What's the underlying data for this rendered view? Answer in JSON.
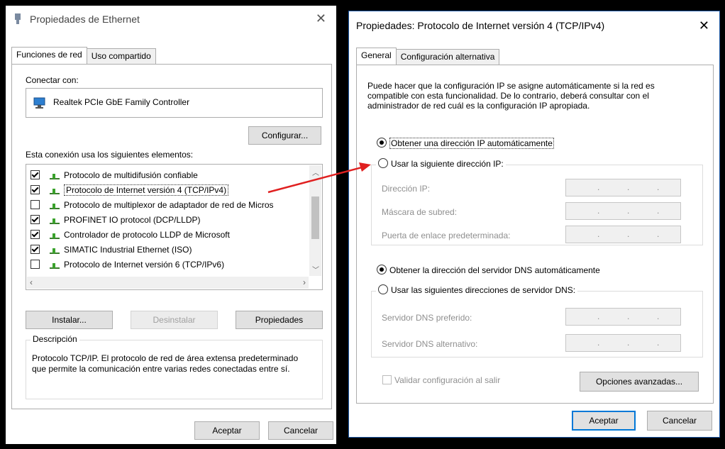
{
  "left": {
    "title": "Propiedades de Ethernet",
    "tabs": [
      "Funciones de red",
      "Uso compartido"
    ],
    "connect_label": "Conectar con:",
    "adapter": "Realtek PCIe GbE Family Controller",
    "configure": "Configurar...",
    "elements_label": "Esta conexión usa los siguientes elementos:",
    "items": [
      {
        "label": "Protocolo de multidifusión confiable",
        "checked": true
      },
      {
        "label": "Protocolo de Internet versión 4 (TCP/IPv4)",
        "checked": true
      },
      {
        "label": "Protocolo de multiplexor de adaptador de red de Micros",
        "checked": false
      },
      {
        "label": "PROFINET IO protocol (DCP/LLDP)",
        "checked": true
      },
      {
        "label": "Controlador de protocolo LLDP de Microsoft",
        "checked": true
      },
      {
        "label": "SIMATIC Industrial Ethernet (ISO)",
        "checked": true
      },
      {
        "label": "Protocolo de Internet versión 6 (TCP/IPv6)",
        "checked": false
      }
    ],
    "install": "Instalar...",
    "uninstall": "Desinstalar",
    "properties": "Propiedades",
    "description_legend": "Descripción",
    "description": "Protocolo TCP/IP. El protocolo de red de área extensa predeterminado que permite la comunicación entre varias redes conectadas entre sí.",
    "ok": "Aceptar",
    "cancel": "Cancelar"
  },
  "right": {
    "title": "Propiedades: Protocolo de Internet versión 4 (TCP/IPv4)",
    "tabs": [
      "General",
      "Configuración alternativa"
    ],
    "intro": "Puede hacer que la configuración IP se asigne automáticamente si la red es compatible con esta funcionalidad. De lo contrario, deberá consultar con el administrador de red cuál es la configuración IP apropiada.",
    "auto_ip": "Obtener una dirección IP automáticamente",
    "use_ip": "Usar la siguiente dirección IP:",
    "ip_address": "Dirección IP:",
    "subnet": "Máscara de subred:",
    "gateway": "Puerta de enlace predeterminada:",
    "auto_dns": "Obtener la dirección del servidor DNS automáticamente",
    "use_dns": "Usar las siguientes direcciones de servidor DNS:",
    "preferred_dns": "Servidor DNS preferido:",
    "alternate_dns": "Servidor DNS alternativo:",
    "validate": "Validar configuración al salir",
    "advanced": "Opciones avanzadas...",
    "ok": "Aceptar",
    "cancel": "Cancelar"
  },
  "colors": {
    "accent": "#0078d7",
    "arrow": "#e02020"
  }
}
